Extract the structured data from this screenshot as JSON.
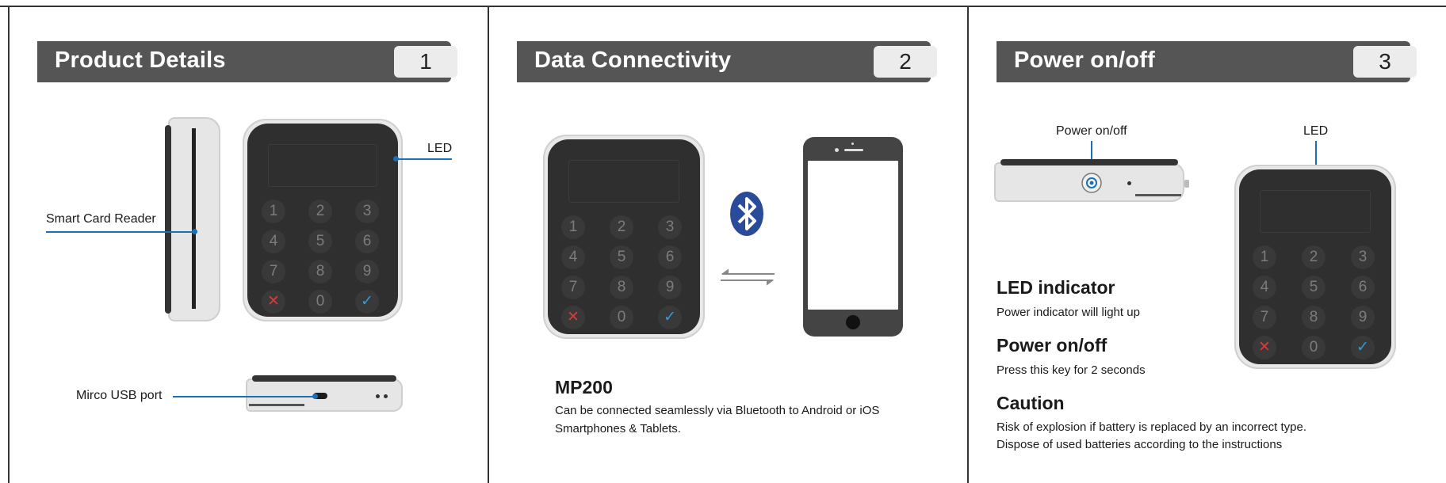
{
  "panels": [
    {
      "title": "Product Details",
      "number": "1"
    },
    {
      "title": "Data Connectivity",
      "number": "2"
    },
    {
      "title": "Power on/off",
      "number": "3"
    }
  ],
  "panel1": {
    "led_label": "LED",
    "card_reader_label": "Smart Card Reader",
    "usb_label": "Mirco USB port"
  },
  "panel2": {
    "model": "MP200",
    "description_line1": "Can be connected seamlessly via Bluetooth to Android or iOS",
    "description_line2": "Smartphones & Tablets."
  },
  "panel3": {
    "power_label": "Power on/off",
    "led_label": "LED",
    "led_heading": "LED indicator",
    "led_text": "Power indicator will light up",
    "power_heading": "Power on/off",
    "power_text": "Press this key for 2 seconds",
    "caution_heading": "Caution",
    "caution_line1": "Risk of explosion if battery is replaced by an incorrect type.",
    "caution_line2": "Dispose of used batteries according to the instructions"
  },
  "keypad": [
    "1",
    "2",
    "3",
    "4",
    "5",
    "6",
    "7",
    "8",
    "9",
    "✕",
    "0",
    "✓"
  ],
  "colors": {
    "accent": "#1a6fb5",
    "header": "#555555",
    "cancel": "#d83a3a",
    "confirm": "#2e9bd6"
  },
  "icons": [
    "bluetooth-icon",
    "sync-arrows-icon",
    "smartphone-icon",
    "power-button-icon"
  ]
}
